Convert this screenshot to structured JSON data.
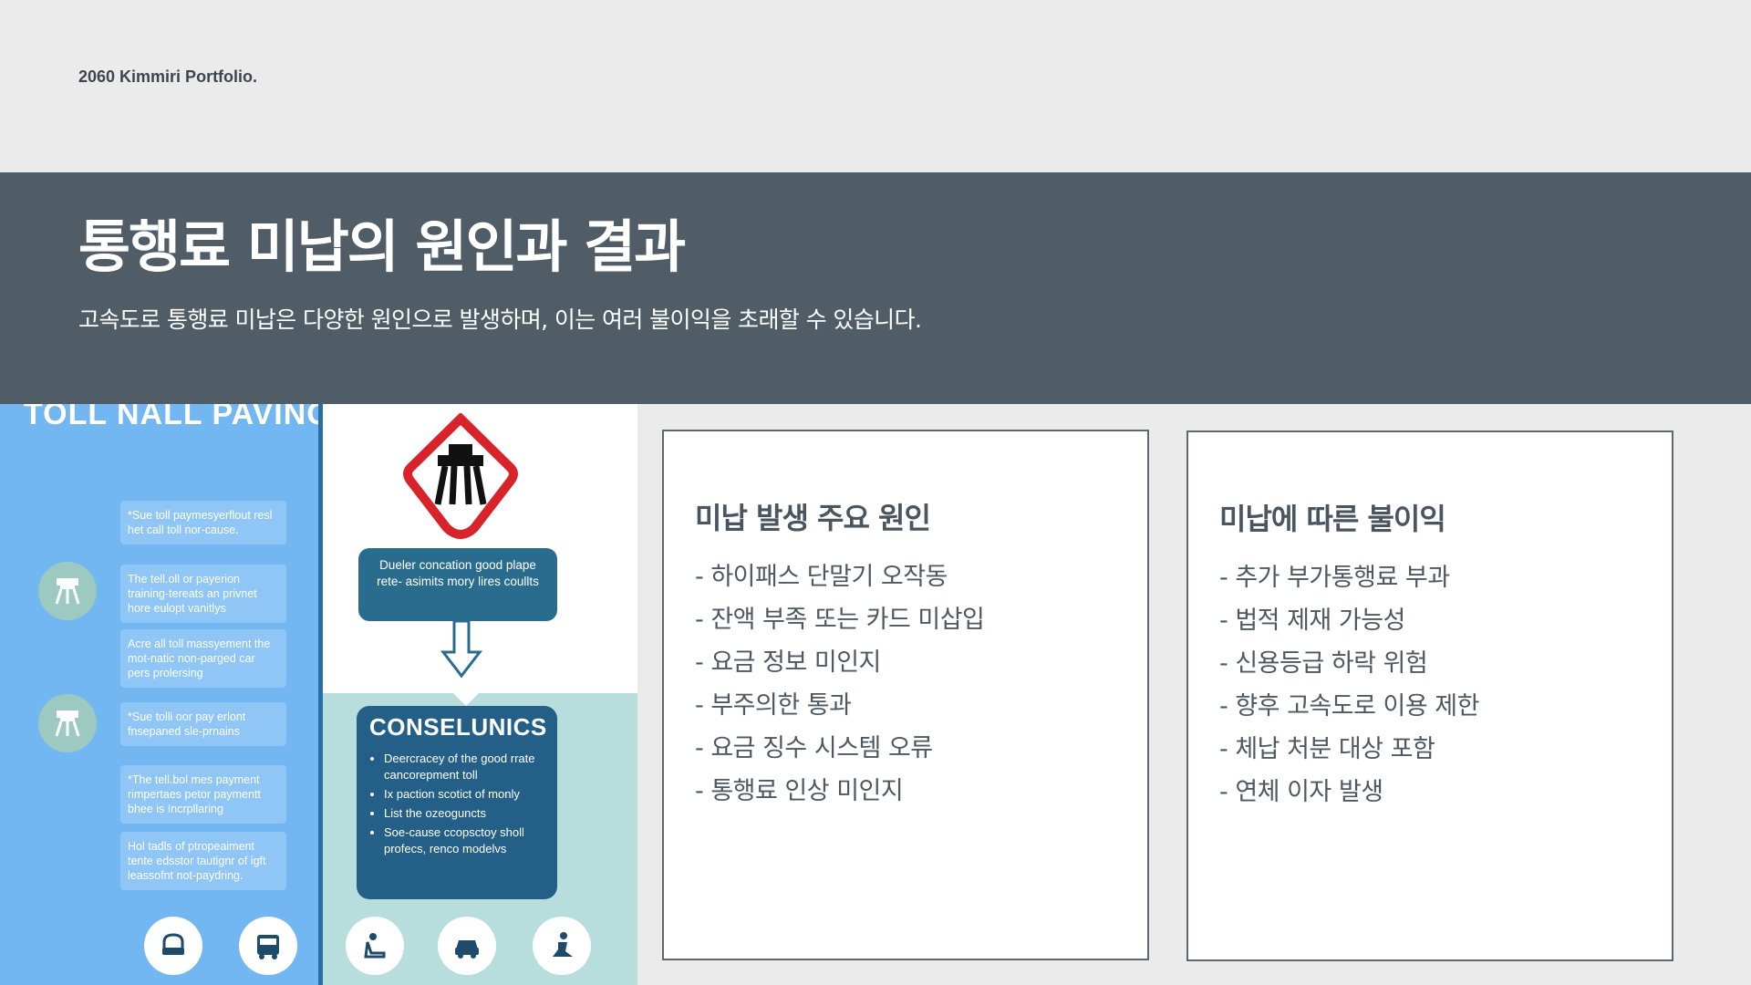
{
  "brand": "2060 Kimmiri Portfolio.",
  "banner": {
    "title": "통행료 미납의 원인과 결과",
    "subtitle": "고속도로 통행료 미납은 다양한 원인으로 발생하며, 이는 여러 불이익을 초래할 수 있습니다."
  },
  "infographic": {
    "heading": "TOLL NALL PAVING",
    "cards": [
      "*Sue toll paymesyerflout resl het call toll nor-cause.",
      "The tell.oll or payerion training-tereats an privnet hore eulopt vanitlys",
      "Acre all toll massyement the mot-natic non-parged car pers prolersing",
      "*Sue tolli oor pay erlont fnsepaned sle-prnains",
      "*The tell.bol mes payment rimpertaes petor paymentt bhee is Incrpllaring",
      "Hol tadls of ptropeaiment tente edsstor tautignr of igft leassofnt not-paydring."
    ],
    "dueler_text": "Dueler concation good plape rete- asimits mory lires coullts",
    "cons_title": "CONSELUNICS",
    "cons_items": [
      "Deercracey of the good rrate cancorepment toll",
      "Ix paction scotict of monly",
      "List the ozeoguncts",
      "Soe-cause ccopsctoy sholl profecs, renco modelvs"
    ],
    "bottom_icons": [
      "car-seat-icon",
      "bus-icon",
      "passenger-icon",
      "car-icon",
      "worker-icon"
    ],
    "colors": {
      "left_bg": "#72b7f2",
      "accent": "#235f86",
      "teal": "#b7dedd",
      "sign_red": "#d8232a"
    }
  },
  "causes": {
    "title": "미납 발생 주요 원인",
    "items": [
      "- 하이패스 단말기 오작동",
      "- 잔액 부족 또는 카드 미삽입",
      "- 요금 정보 미인지",
      "- 부주의한 통과",
      "- 요금 징수 시스템 오류",
      "- 통행료 인상 미인지"
    ]
  },
  "effects": {
    "title": "미납에 따른 불이익",
    "items": [
      "- 추가 부가통행료 부과",
      "- 법적 제재 가능성",
      "- 신용등급 하락 위험",
      "- 향후 고속도로 이용 제한",
      "- 체납 처분 대상 포함",
      "- 연체 이자 발생"
    ]
  },
  "colors": {
    "banner": "#515d66",
    "page_bg": "#ebebeb",
    "box_border": "#5d6872"
  }
}
